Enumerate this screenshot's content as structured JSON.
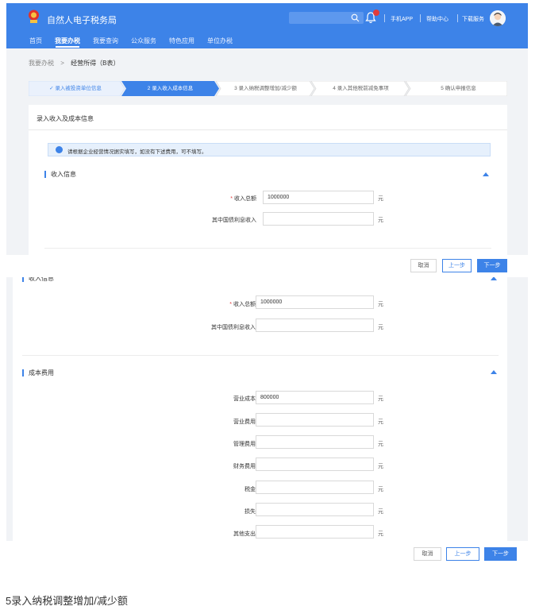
{
  "header": {
    "title": "自然人电子税务局",
    "links": [
      "手机APP",
      "帮助中心",
      "下载服务"
    ]
  },
  "nav": {
    "items": [
      "首页",
      "我要办税",
      "我要查询",
      "公众服务",
      "特色应用",
      "单位办税"
    ]
  },
  "breadcrumb": {
    "parent": "我要办税",
    "separator": ">",
    "current": "经营所得（B表）"
  },
  "steps": [
    {
      "label": "✓ 录入被投资单位信息",
      "state": "done"
    },
    {
      "label": "2 录入收入成本信息",
      "state": "active"
    },
    {
      "label": "3 录入纳税调整增加/减少额",
      "state": "pending"
    },
    {
      "label": "4 录入其他税前减免事项",
      "state": "pending"
    },
    {
      "label": "5 确认申报信息",
      "state": "pending"
    }
  ],
  "section": {
    "title": "录入收入及成本信息",
    "notice": "请根据企业经营情况据实填写，如没有下述费用，可不填写。"
  },
  "income": {
    "title": "收入信息",
    "total_label": "收入总额",
    "total_value": "1000000",
    "interest_label": "其中国债利息收入",
    "interest_value": ""
  },
  "cost": {
    "title": "成本费用",
    "fields": [
      {
        "label": "营业成本",
        "value": "800000"
      },
      {
        "label": "营业费用",
        "value": ""
      },
      {
        "label": "管理费用",
        "value": ""
      },
      {
        "label": "财务费用",
        "value": ""
      },
      {
        "label": "税金",
        "value": ""
      },
      {
        "label": "损失",
        "value": ""
      },
      {
        "label": "其他支出",
        "value": ""
      }
    ]
  },
  "unit": "元",
  "buttons": {
    "cancel": "取消",
    "prev": "上一步",
    "next": "下一步"
  },
  "caption": "5录入纳税调整增加/减少额",
  "colors": {
    "primary": "#3d83e8",
    "required": "#e23b3b",
    "background": "#f1f3f6"
  }
}
